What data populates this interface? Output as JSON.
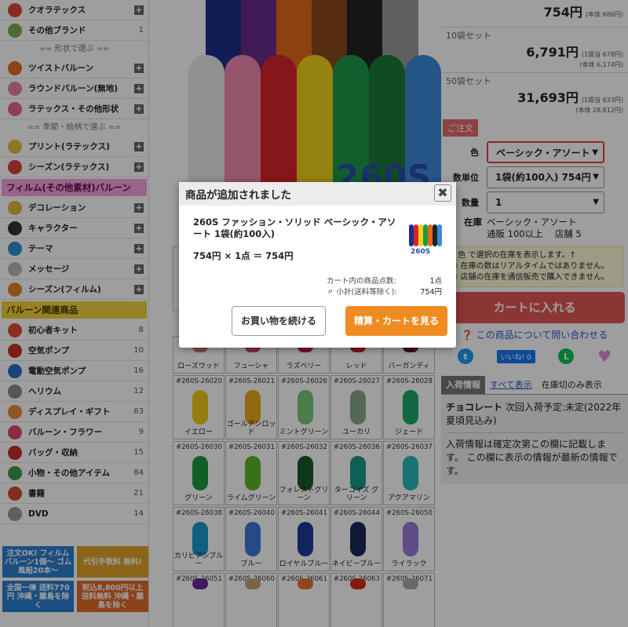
{
  "sidebar": {
    "items_top": [
      {
        "label": "クオラテックス",
        "icon": "qualatex-icon",
        "color": "#d9473b",
        "action": "plus"
      },
      {
        "label": "その他ブランド",
        "icon": "brand-icon",
        "color": "#7fae4b",
        "count": "1"
      }
    ],
    "shape_heading": "== 形状で選ぶ ==",
    "shape_items": [
      {
        "label": "ツイストバルーン",
        "icon": "twist-balloon-icon",
        "color": "#e36c2a",
        "action": "plus"
      },
      {
        "label": "ラウンドバルーン(無地)",
        "icon": "round-balloon-icon",
        "color": "#e7839f",
        "action": "plus"
      },
      {
        "label": "ラテックス・その他形状",
        "icon": "heart-balloon-icon",
        "color": "#e6659c",
        "action": "plus"
      }
    ],
    "season_heading": "== 季節・絵柄で選ぶ ==",
    "season_items": [
      {
        "label": "プリント(ラテックス)",
        "icon": "print-balloon-icon",
        "color": "#e4c13c",
        "action": "plus"
      },
      {
        "label": "シーズン(ラテックス)",
        "icon": "season-balloon-icon",
        "color": "#d8433c",
        "action": "plus"
      }
    ],
    "film_heading": "フィルム(その他素材)バルーン",
    "film_items": [
      {
        "label": "デコレーション",
        "icon": "decoration-icon",
        "color": "#e4b63a",
        "action": "plus"
      },
      {
        "label": "キャラクター",
        "icon": "character-icon",
        "color": "#333333",
        "action": "plus"
      },
      {
        "label": "テーマ",
        "icon": "theme-icon",
        "color": "#2e8fd2",
        "action": "plus"
      },
      {
        "label": "メッセージ",
        "icon": "message-icon",
        "color": "#b9b9b9",
        "action": "plus"
      },
      {
        "label": "シーズン(フィルム)",
        "icon": "pumpkin-icon",
        "color": "#e6832b",
        "action": "plus"
      }
    ],
    "related_heading": "バルーン関連商品",
    "related_items": [
      {
        "label": "初心者キット",
        "icon": "kit-icon",
        "color": "#e34a3a",
        "count": "8"
      },
      {
        "label": "空気ポンプ",
        "icon": "pump-icon",
        "color": "#c8302a",
        "count": "10"
      },
      {
        "label": "電動空気ポンプ",
        "icon": "electric-pump-icon",
        "color": "#2a6fc8",
        "count": "16"
      },
      {
        "label": "ヘリウム",
        "icon": "helium-icon",
        "color": "#8c8c8c",
        "count": "12"
      },
      {
        "label": "ディスプレイ・ギフト",
        "icon": "rainbow-icon",
        "color": "#e8893a",
        "count": "63"
      },
      {
        "label": "バルーン・フラワー",
        "icon": "flower-icon",
        "color": "#d84a6e",
        "count": "9"
      },
      {
        "label": "バッグ・収納",
        "icon": "bag-icon",
        "color": "#c62e2e",
        "count": "15"
      },
      {
        "label": "小物・その他アイテム",
        "icon": "tools-icon",
        "color": "#3c9a4c",
        "count": "84"
      },
      {
        "label": "書籍",
        "icon": "book-icon",
        "color": "#d44a2e",
        "count": "21"
      },
      {
        "label": "DVD",
        "icon": "dvd-icon",
        "color": "#9a9a9a",
        "count": "14"
      }
    ],
    "banners": [
      {
        "text": "注文OK! フィルムバルーン1個〜 ゴム風船20本〜",
        "color": "#2c7fd0"
      },
      {
        "text": "代引手数料 無料!",
        "color": "#e0a32a"
      },
      {
        "text": "全国一律 送料770円 沖縄・離島を除く",
        "color": "#2c7fd0"
      },
      {
        "text": "税込8,800円以上 送料無料 沖縄・離島を除く",
        "color": "#e06a2a"
      }
    ]
  },
  "hero": {
    "tag": "260S",
    "balloon_colors_back": [
      "#1e2f8c",
      "#6a2c8c",
      "#e46a1a",
      "#8a4a1e",
      "#222222",
      "#9a9a9a"
    ],
    "balloon_colors_front": [
      "#e8e8e8",
      "#f08ab0",
      "#d8252a",
      "#f3d21c",
      "#1e9a4a",
      "#1a7a3a",
      "#3a8ad8"
    ]
  },
  "grid": {
    "row0_names": [
      "ローズウッド",
      "フューシャ",
      "ラズベリー",
      "レッド",
      "バーガンディ"
    ],
    "row0_colors": [
      "#c87a7a",
      "#d4408a",
      "#c2204a",
      "#d42020",
      "#6a1a2a"
    ],
    "rows": [
      {
        "codes": [
          "#260S-26020",
          "#260S-26021",
          "#260S-26026",
          "#260S-26027",
          "#260S-26028"
        ],
        "names": [
          "イエロー",
          "ゴールデンロッド",
          "ミントグリーン",
          "ユーカリ",
          "ジェード"
        ],
        "colors": [
          "#f0c81a",
          "#e8a81a",
          "#7ac87a",
          "#8aa88a",
          "#1ea86a"
        ]
      },
      {
        "codes": [
          "#260S-26030",
          "#260S-26031",
          "#260S-26032",
          "#260S-26036",
          "#260S-26037"
        ],
        "names": [
          "グリーン",
          "ライムグリーン",
          "フォレストグリーン",
          "ターコイズ グリーン",
          "アクアマリン"
        ],
        "colors": [
          "#1a9a3a",
          "#5ab82a",
          "#1a5a2a",
          "#1a9a8a",
          "#2ab8b8"
        ]
      },
      {
        "codes": [
          "#260S-26038",
          "#260S-26040",
          "#260S-26041",
          "#260S-26044",
          "#260S-26050"
        ],
        "names": [
          "カリビアンブルー",
          "ブルー",
          "ロイヤルブルー",
          "ネイビーブルー",
          "ライラック"
        ],
        "colors": [
          "#1a9ac8",
          "#3a7ad8",
          "#1a3a9a",
          "#1a2a5a",
          "#9a7ad8"
        ]
      },
      {
        "codes": [
          "#260S-26051",
          "#260S-26060",
          "#260S-26061",
          "#260S-26063",
          "#260S-26071"
        ],
        "names": [
          "",
          "",
          "",
          "",
          ""
        ],
        "colors": [
          "#6a2a9a",
          "#c8a07a",
          "#e8702a",
          "#d82a1a",
          "#a8a8a8"
        ]
      }
    ]
  },
  "right": {
    "price1": "754円",
    "price1_note": "(本体 686円)",
    "set10_label": "10袋セット",
    "set10_price": "6,791円",
    "set10_note1": "(1袋当 678円)",
    "set10_note2": "(本体 6,174円)",
    "set50_label": "50袋セット",
    "set50_price": "31,693円",
    "set50_note1": "(1袋当 633円)",
    "set50_note2": "(本体 28,812円)",
    "order_badge": "ご注文",
    "color_label": "色",
    "color_value": "ベーシック・アソート",
    "unit_label": "数単位",
    "unit_value": "1袋(約100入) 754円",
    "qty_label": "数量",
    "qty_value": "1",
    "stock_label": "在庫",
    "stock_line1": "ベーシック・アソート",
    "stock_line2": "通販 100以上　 店舗 5",
    "notes": [
      "↑色 で選択の在庫を表示します。↑",
      "※ 在庫の数はリアルタイムではありません。",
      "※ 店舗の在庫を通信販売で購入できません。"
    ],
    "cart_button": "カートに入れる",
    "ask": "この商品について問い合わせる",
    "like": "いいね! 0",
    "tabs": [
      "入荷情報",
      "すべて表示",
      "在庫切のみ表示"
    ],
    "info_title": "チョコレート",
    "info_title_rest": " 次回入荷予定:未定(2022年夏頃見込み)",
    "info_body": "入荷情報は確定次第この欄に記載します。 この欄に表示の情報が最新の情報です。"
  },
  "modal": {
    "title": "商品が追加されました",
    "product": "260S ファッション・ソリッド ベーシック・アソート 1袋(約100入)",
    "price_line": "754円 × 1点 ＝ 754円",
    "count_label": "カート内の商品点数:",
    "count_value": "1点",
    "subtotal_label": "〃 小計(送料等除く):",
    "subtotal_value": "754円",
    "continue_label": "お買い物を続ける",
    "checkout_label": "精算・カートを見る",
    "thumb_tag": "260S",
    "thumb_colors": [
      "#1e2f8c",
      "#d8252a",
      "#f3d21c",
      "#1e9a4a",
      "#e46a1a",
      "#222222",
      "#3a8ad8"
    ]
  }
}
